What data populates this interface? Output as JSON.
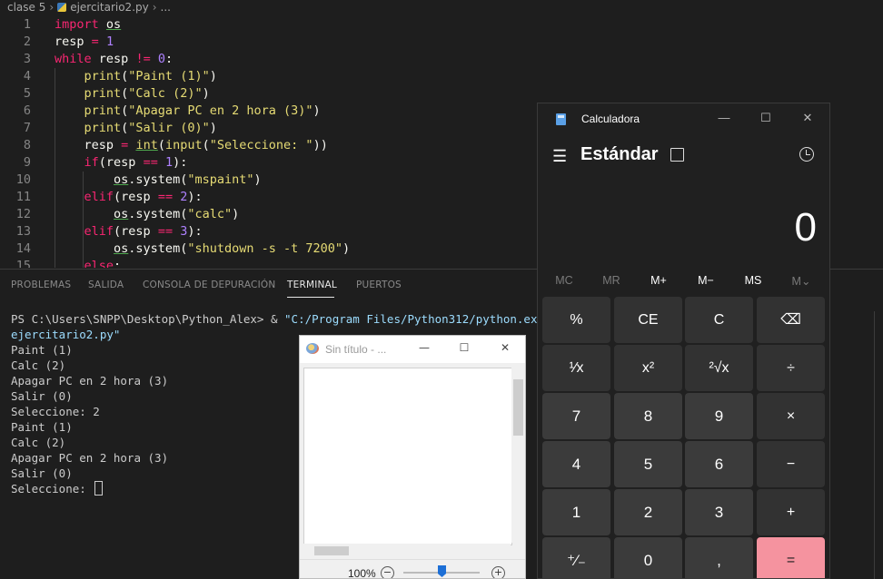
{
  "breadcrumb": {
    "folder": "clase 5",
    "file": "ejercitario2.py",
    "more": "..."
  },
  "editor": {
    "line_numbers": [
      "1",
      "2",
      "3",
      "4",
      "5",
      "6",
      "7",
      "8",
      "9",
      "10",
      "11",
      "12",
      "13",
      "14",
      "15"
    ]
  },
  "panel": {
    "tabs": [
      "PROBLEMAS",
      "SALIDA",
      "CONSOLA DE DEPURACIÓN",
      "TERMINAL",
      "PUERTOS"
    ],
    "active_tab": "TERMINAL"
  },
  "terminal": {
    "prompt": "PS C:\\Users\\SNPP\\Desktop\\Python_Alex> & ",
    "exe": "\"C:/Program Files/Python312/python.exe\" \"c:",
    "script_tail": "ejercitario2.py\"",
    "lines": [
      "Paint (1)",
      "Calc (2)",
      "Apagar PC en 2 hora (3)",
      "Salir (0)",
      "Seleccione: 2",
      "Paint (1)",
      "Calc (2)",
      "Apagar PC en 2 hora (3)",
      "Salir (0)"
    ],
    "last_prompt": "Seleccione: "
  },
  "paint": {
    "title": "Sin título - ...",
    "zoom": "100%",
    "minimize": "—",
    "maximize": "☐",
    "close": "✕",
    "zoom_out": "−",
    "zoom_in": "+"
  },
  "calculator": {
    "title": "Calculadora",
    "mode": "Estándar",
    "display": "0",
    "menu_icon": "☰",
    "window_minimize": "—",
    "window_maximize": "☐",
    "window_close": "✕",
    "memory": [
      "MC",
      "MR",
      "M+",
      "M−",
      "MS",
      "M⌄"
    ],
    "keys": [
      [
        "%",
        "CE",
        "C",
        "⌫"
      ],
      [
        "¹⁄x",
        "x²",
        "²√x",
        "÷"
      ],
      [
        "7",
        "8",
        "9",
        "×"
      ],
      [
        "4",
        "5",
        "6",
        "−"
      ],
      [
        "1",
        "2",
        "3",
        "+"
      ],
      [
        "⁺⁄₋",
        "0",
        ",",
        "="
      ]
    ]
  }
}
